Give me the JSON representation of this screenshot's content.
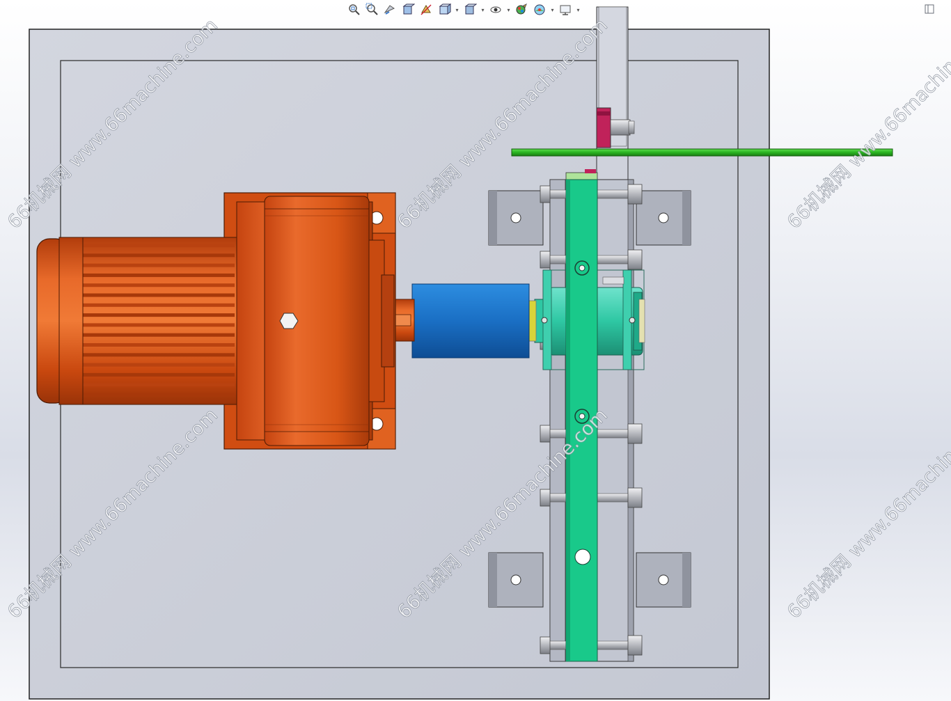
{
  "app": {
    "name": "CAD 3D viewer",
    "watermark_text": "66机械网 www.66machine.com"
  },
  "toolbar": {
    "items": [
      {
        "icon": "zoom-to-fit-icon"
      },
      {
        "icon": "zoom-to-area-icon"
      },
      {
        "icon": "previous-view-icon"
      },
      {
        "icon": "section-view-icon"
      },
      {
        "icon": "dynamic-annotation-views-icon"
      },
      {
        "icon": "view-orientation-icon",
        "has_dropdown": true
      },
      {
        "icon": "display-style-icon",
        "has_dropdown": true
      },
      {
        "icon": "hide-show-items-icon",
        "has_dropdown": true
      },
      {
        "icon": "edit-appearance-icon"
      },
      {
        "icon": "apply-scene-icon",
        "has_dropdown": true
      },
      {
        "icon": "view-settings-icon",
        "has_dropdown": true
      }
    ],
    "corner_icon": "restore-panel-icon"
  },
  "model": {
    "parts": [
      {
        "name": "base-plate",
        "color": "#c9ccd6"
      },
      {
        "name": "gear-motor",
        "color": "#d9541a"
      },
      {
        "name": "coupling",
        "color": "#1a6fc4"
      },
      {
        "name": "bearing-housing",
        "color": "#2ec7a3"
      },
      {
        "name": "vertical-bar",
        "color": "#19c98a"
      },
      {
        "name": "guide-rod",
        "color": "#29b321"
      },
      {
        "name": "stop-block",
        "color": "#c0225a"
      },
      {
        "name": "mounting-brackets",
        "color": "#aeb2bd"
      }
    ]
  }
}
